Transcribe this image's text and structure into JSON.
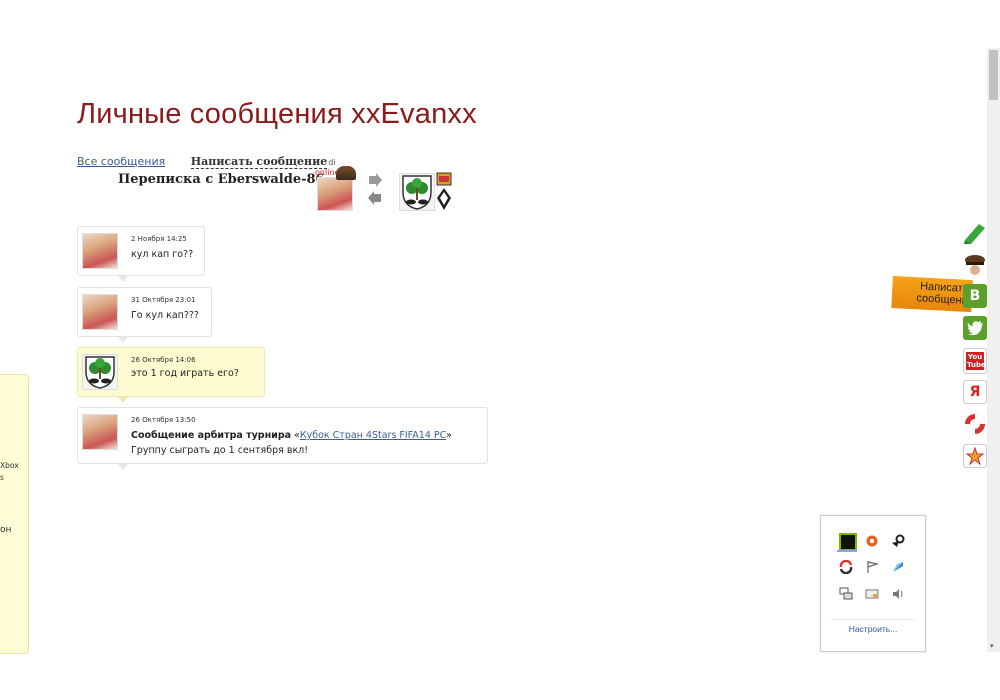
{
  "page": {
    "title": "Личные сообщения xxEvanxx",
    "nav_all": "Все сообщения",
    "nav_write": "Написать сообщение",
    "nav_tiny": "di",
    "conversation_title": "Переписка с Eberswalde-86",
    "online_label": "online"
  },
  "messages": [
    {
      "date": "2 Ноября 14:25",
      "text": "кул кап го??"
    },
    {
      "date": "31 Октября 23:01",
      "text": "Го кул кап???"
    },
    {
      "date": "26 Октября 14:06",
      "text": "это 1 год играть его?"
    },
    {
      "date": "26 Октября 13:50",
      "bold": "Сообщение арбитра турнира",
      "quote_open": " «",
      "link": "Кубок Стран 4Stars FIFA14 PC",
      "quote_close": "»",
      "line2": "Группу сыграть до 1 сентября вкл!"
    }
  ],
  "left_panel": {
    "line1": "Xbox",
    "line2": "s",
    "line3": "он"
  },
  "side_tab": {
    "line1": "Написать",
    "line2": "сообщени"
  },
  "side_icons": [
    "edit-icon",
    "avatar-icon",
    "vk-icon",
    "twitter-icon",
    "youtube-icon",
    "yandex-icon",
    "lifebuoy-icon",
    "star-icon"
  ],
  "side_labels": {
    "vk": "B",
    "yandex": "Я",
    "youtube": "You Tube"
  },
  "tray": {
    "icons": [
      "nvidia-icon",
      "record-icon",
      "steam-icon",
      "sync-icon",
      "flag-icon",
      "network-tool-icon",
      "network-icon",
      "display-icon",
      "volume-icon"
    ],
    "customize": "Настроить..."
  }
}
